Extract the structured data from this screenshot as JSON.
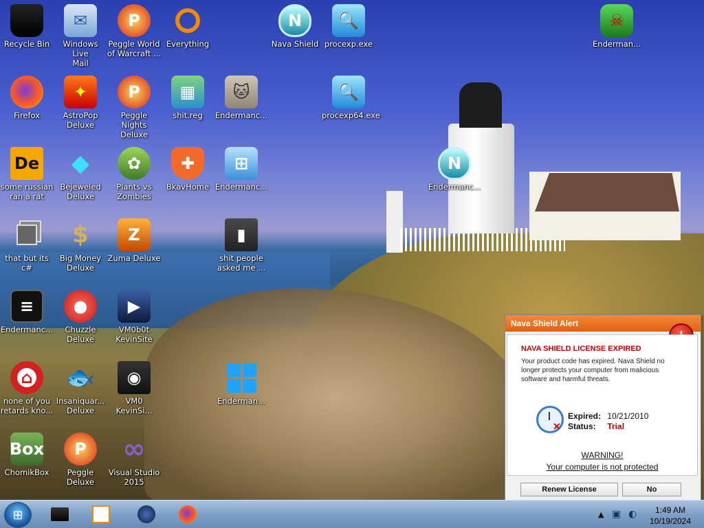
{
  "desktop": {
    "icons": [
      {
        "label": "Recycle Bin"
      },
      {
        "label": "Windows Live\nMail"
      },
      {
        "label": "Peggle World\nof Warcraft ..."
      },
      {
        "label": "Everything"
      },
      {
        "label": "Nava Shield"
      },
      {
        "label": "procexp.exe"
      },
      {
        "label": "Enderman..."
      },
      {
        "label": "Firefox"
      },
      {
        "label": "AstroPop\nDeluxe"
      },
      {
        "label": "Peggle Nights\nDeluxe"
      },
      {
        "label": "shit.reg"
      },
      {
        "label": "Endermanc..."
      },
      {
        "label": "procexp64.exe"
      },
      {
        "label": "some russian\nran a rat"
      },
      {
        "label": "Bejeweled\nDeluxe"
      },
      {
        "label": "Plants vs\nZombies"
      },
      {
        "label": "BkavHome"
      },
      {
        "label": "Endermanc..."
      },
      {
        "label": "Endermanc..."
      },
      {
        "label": "that but its c#"
      },
      {
        "label": "Big Money\nDeluxe"
      },
      {
        "label": "Zuma Deluxe"
      },
      {
        "label": "shit people\nasked me ..."
      },
      {
        "label": "Endermanc..."
      },
      {
        "label": "Chuzzle\nDeluxe"
      },
      {
        "label": "VM0b0t\nKevinSite"
      },
      {
        "label": "none of you\nretards kno..."
      },
      {
        "label": "Insaniquar...\nDeluxe"
      },
      {
        "label": "VM0\nKevinSi..."
      },
      {
        "label": "Enderman..."
      },
      {
        "label": "ChomikBox"
      },
      {
        "label": "Peggle Deluxe"
      },
      {
        "label": "Visual Studio\n2015"
      }
    ],
    "glyphs": {
      "mail": "✉",
      "peggle": "P",
      "shield": "N",
      "proc": "🔍",
      "dragon": "☠",
      "astro": "✦",
      "reg": "▦",
      "cat": "🐱",
      "de": "De",
      "gem": "◆",
      "plant": "✿",
      "bkav": "✚",
      "win7": "⊞",
      "money": "$",
      "zuma": "Z",
      "folder": "▮",
      "term": "≡",
      "chuzzle": "●",
      "vm": "▶",
      "red": "⌂",
      "fish": "🐟",
      "vm0": "◉",
      "chomik": "Box",
      "vs": "∞",
      "nvscan": "N"
    }
  },
  "alert": {
    "title": "Nava Shield Alert",
    "stop_glyph": "!",
    "headline": "NAVA SHIELD LICENSE EXPIRED",
    "message": "Your product code has expired. Nava Shield no longer protects your computer from malicious software and harmful threats.",
    "expired_label": "Expired:",
    "expired_value": "10/21/2010",
    "status_label": "Status:",
    "status_value": "Trial",
    "warning_title": "WARNING!",
    "warning_text": "Your computer is not protected",
    "renew_button": "Renew License",
    "no_button": "No"
  },
  "taskbar": {
    "start_glyph": "⊞",
    "tray_up": "▲",
    "tray_monitor": "▣",
    "tray_network": "◐",
    "time": "1:49 AM",
    "date": "10/19/2024"
  }
}
